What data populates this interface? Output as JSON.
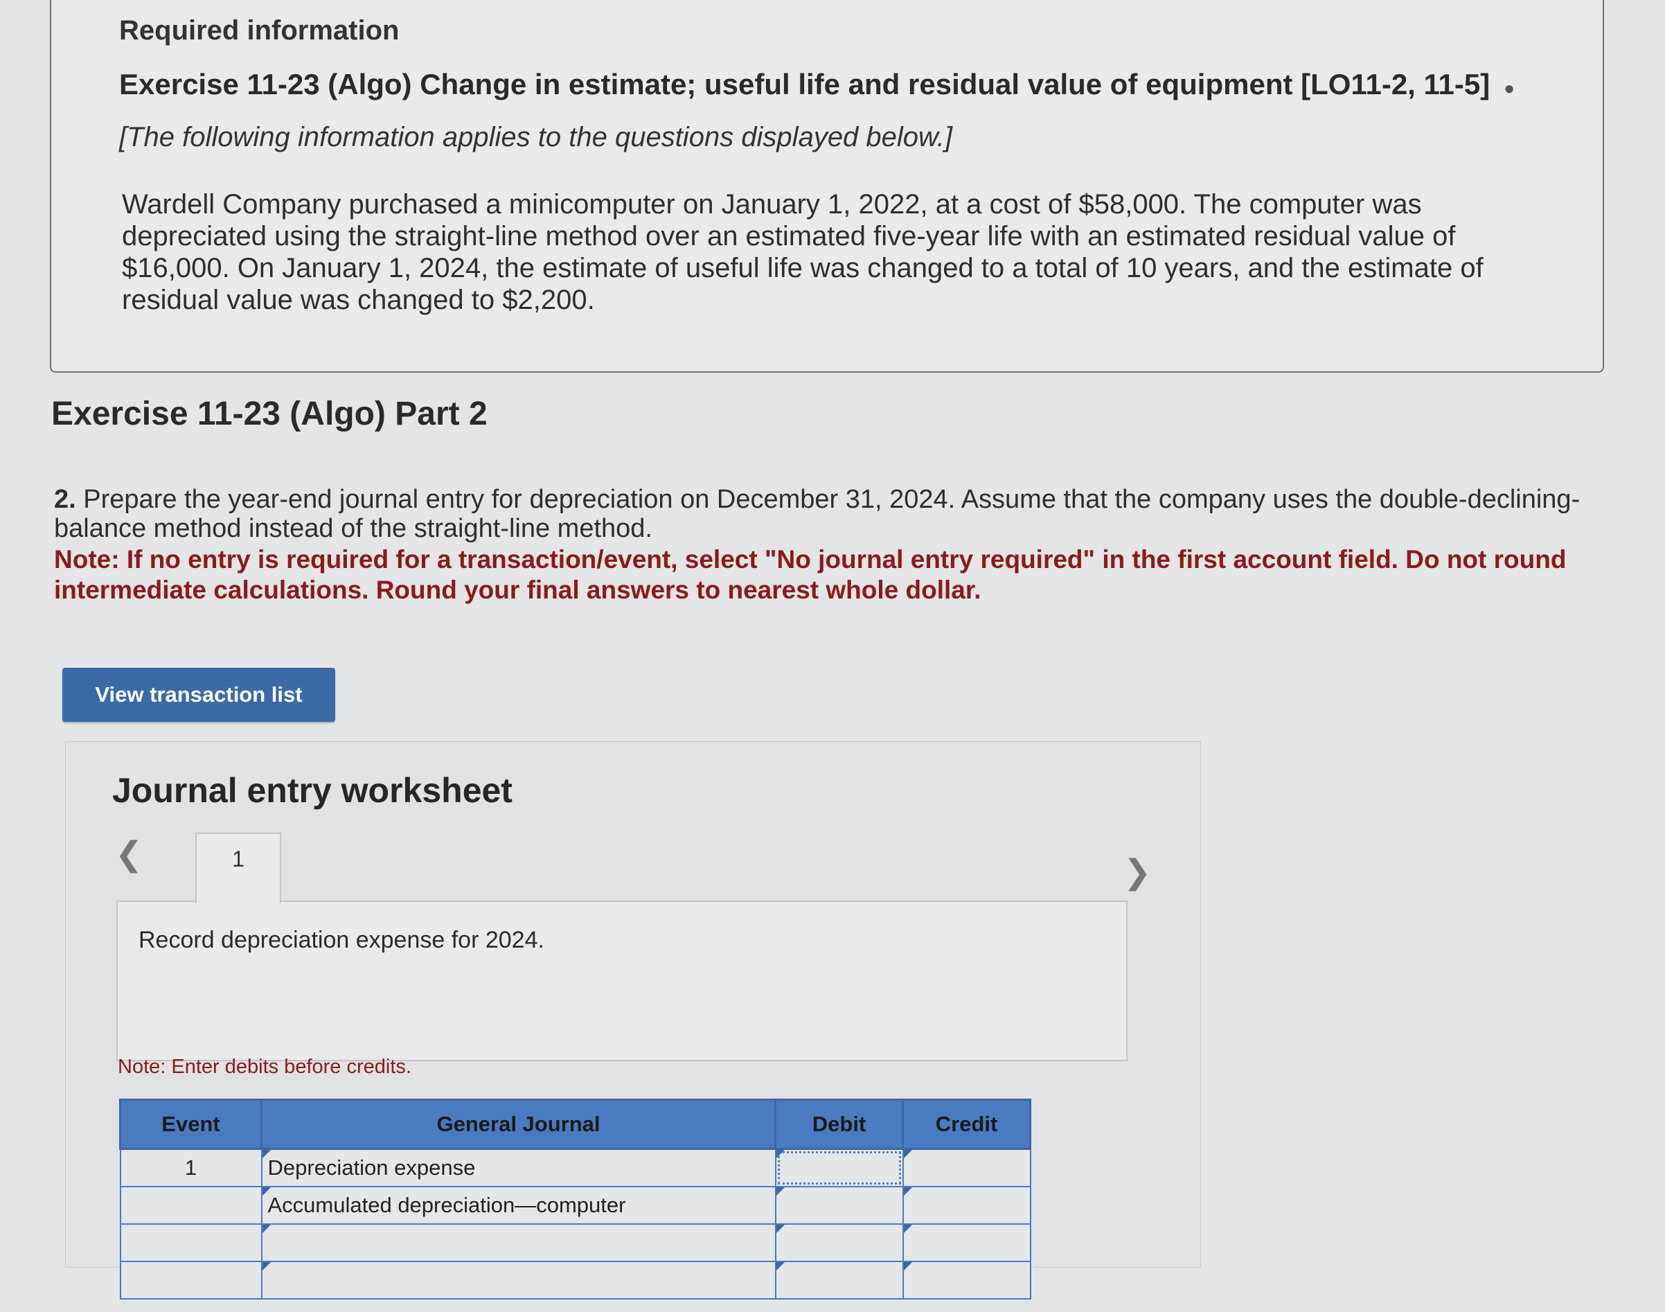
{
  "required_info": {
    "title": "Required information",
    "exercise_title": "Exercise 11-23 (Algo) Change in estimate; useful life and residual value of equipment [LO11-2, 11-5]",
    "applies": "[The following information applies to the questions displayed below.]",
    "scenario": "Wardell Company purchased a minicomputer on January 1, 2022, at a cost of $58,000. The computer was depreciated using the straight-line method over an estimated five-year life with an estimated residual value of $16,000. On January 1, 2024, the estimate of useful life was changed to a total of 10 years, and the estimate of residual value was changed to $2,200."
  },
  "part": {
    "title": "Exercise 11-23 (Algo) Part 2",
    "question_number": "2.",
    "question": "Prepare the year-end journal entry for depreciation on December 31, 2024. Assume that the company uses the double-declining-balance method instead of the straight-line method.",
    "note": "Note: If no entry is required for a transaction/event, select \"No journal entry required\" in the first account field. Do not round intermediate calculations. Round your final answers to nearest whole dollar."
  },
  "view_transaction_list_label": "View transaction list",
  "worksheet": {
    "title": "Journal entry worksheet",
    "tabs": [
      "1"
    ],
    "instruction": "Record depreciation expense for 2024.",
    "enter_note": "Note: Enter debits before credits.",
    "columns": [
      "Event",
      "General Journal",
      "Debit",
      "Credit"
    ],
    "rows": [
      {
        "event": "1",
        "account": "Depreciation expense",
        "debit": "",
        "credit": ""
      },
      {
        "event": "",
        "account": "Accumulated depreciation—computer",
        "debit": "",
        "credit": ""
      },
      {
        "event": "",
        "account": "",
        "debit": "",
        "credit": ""
      },
      {
        "event": "",
        "account": "",
        "debit": "",
        "credit": ""
      }
    ]
  }
}
